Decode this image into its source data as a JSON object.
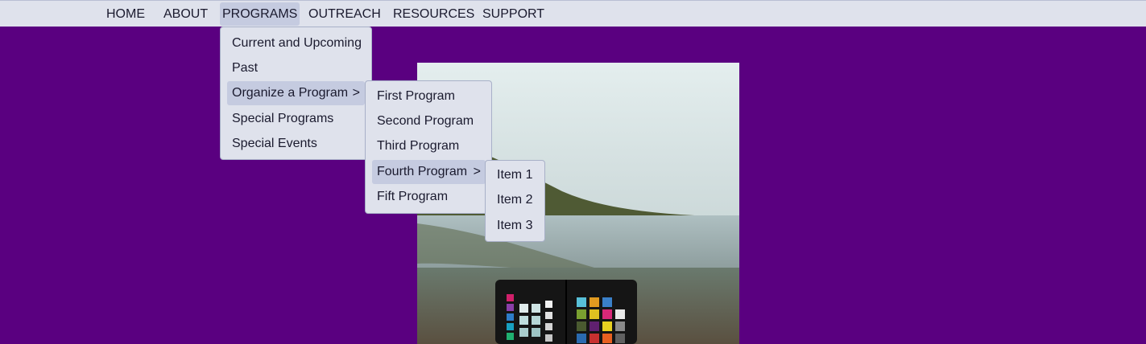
{
  "nav": {
    "items": [
      "HOME",
      "ABOUT",
      "PROGRAMS",
      "OUTREACH",
      "RESOURCES",
      "SUPPORT"
    ],
    "active": "PROGRAMS"
  },
  "programs_menu": {
    "items": [
      "Current and Upcoming",
      "Past",
      "Organize a Program",
      "Special Programs",
      "Special Events"
    ],
    "submenu_indicator": ">"
  },
  "organize_menu": {
    "items": [
      "First Program",
      "Second Program",
      "Third Program",
      "Fourth Program",
      "Fift Program"
    ],
    "submenu_indicator": ">"
  },
  "fourth_menu": {
    "items": [
      "Item 1",
      "Item 2",
      "Item 3"
    ]
  },
  "colors": {
    "background": "#5a0080",
    "navbar": "#dfe2ec",
    "highlight": "#c5cbe0"
  }
}
